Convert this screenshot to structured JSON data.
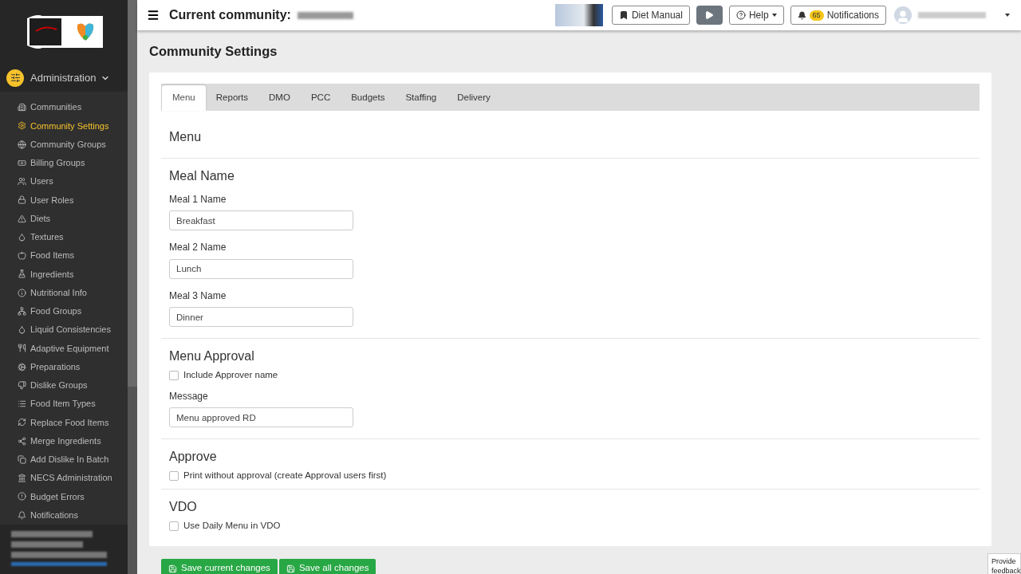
{
  "sidebar": {
    "section": {
      "label": "Administration",
      "expanded": true
    },
    "items": [
      {
        "label": "Communities",
        "selected": false
      },
      {
        "label": "Community Settings",
        "selected": true
      },
      {
        "label": "Community Groups",
        "selected": false
      },
      {
        "label": "Billing Groups",
        "selected": false
      },
      {
        "label": "Users",
        "selected": false
      },
      {
        "label": "User Roles",
        "selected": false
      },
      {
        "label": "Diets",
        "selected": false
      },
      {
        "label": "Textures",
        "selected": false
      },
      {
        "label": "Food Items",
        "selected": false
      },
      {
        "label": "Ingredients",
        "selected": false
      },
      {
        "label": "Nutritional Info",
        "selected": false
      },
      {
        "label": "Food Groups",
        "selected": false
      },
      {
        "label": "Liquid Consistencies",
        "selected": false
      },
      {
        "label": "Adaptive Equipment",
        "selected": false
      },
      {
        "label": "Preparations",
        "selected": false
      },
      {
        "label": "Dislike Groups",
        "selected": false
      },
      {
        "label": "Food Item Types",
        "selected": false
      },
      {
        "label": "Replace Food Items",
        "selected": false
      },
      {
        "label": "Merge Ingredients",
        "selected": false
      },
      {
        "label": "Add Dislike In Batch",
        "selected": false
      },
      {
        "label": "NECS Administration",
        "selected": false
      },
      {
        "label": "Budget Errors",
        "selected": false
      },
      {
        "label": "Notifications",
        "selected": false
      }
    ]
  },
  "topbar": {
    "title": "Current community:",
    "buttons": [
      {
        "kind": "diet",
        "label": "Diet Manual"
      },
      {
        "kind": "play"
      },
      {
        "kind": "help",
        "label": "Help"
      },
      {
        "kind": "notifications",
        "label": "Notifications",
        "badge": "65"
      }
    ]
  },
  "page": {
    "title": "Community Settings",
    "tabs": [
      {
        "label": "Menu",
        "selected": true
      },
      {
        "label": "Reports",
        "selected": false
      },
      {
        "label": "DMO",
        "selected": false
      },
      {
        "label": "PCC",
        "selected": false
      },
      {
        "label": "Budgets",
        "selected": false
      },
      {
        "label": "Staffing",
        "selected": false
      },
      {
        "label": "Delivery",
        "selected": false
      }
    ],
    "heading": "Menu",
    "sections": [
      {
        "title": "Meal Name",
        "fields": [
          {
            "kind": "text",
            "label": "Meal 1 Name",
            "value": "Breakfast"
          },
          {
            "kind": "text",
            "label": "Meal 2 Name",
            "value": "Lunch"
          },
          {
            "kind": "text",
            "label": "Meal 3 Name",
            "value": "Dinner"
          }
        ]
      },
      {
        "title": "Menu Approval",
        "fields": [
          {
            "kind": "checkbox",
            "label": "Include Approver name",
            "checked": false
          },
          {
            "kind": "text",
            "label": "Message",
            "value": "Menu approved RD"
          }
        ]
      },
      {
        "title": "Approve",
        "fields": [
          {
            "kind": "checkbox",
            "label": "Print without approval (create Approval users first)",
            "checked": false
          }
        ]
      },
      {
        "title": "VDO",
        "fields": [
          {
            "kind": "checkbox",
            "label": "Use Daily Menu in VDO",
            "checked": false
          }
        ]
      }
    ],
    "actions": [
      "Save current changes",
      "Save all changes"
    ]
  },
  "feedback": "Provide feedback"
}
